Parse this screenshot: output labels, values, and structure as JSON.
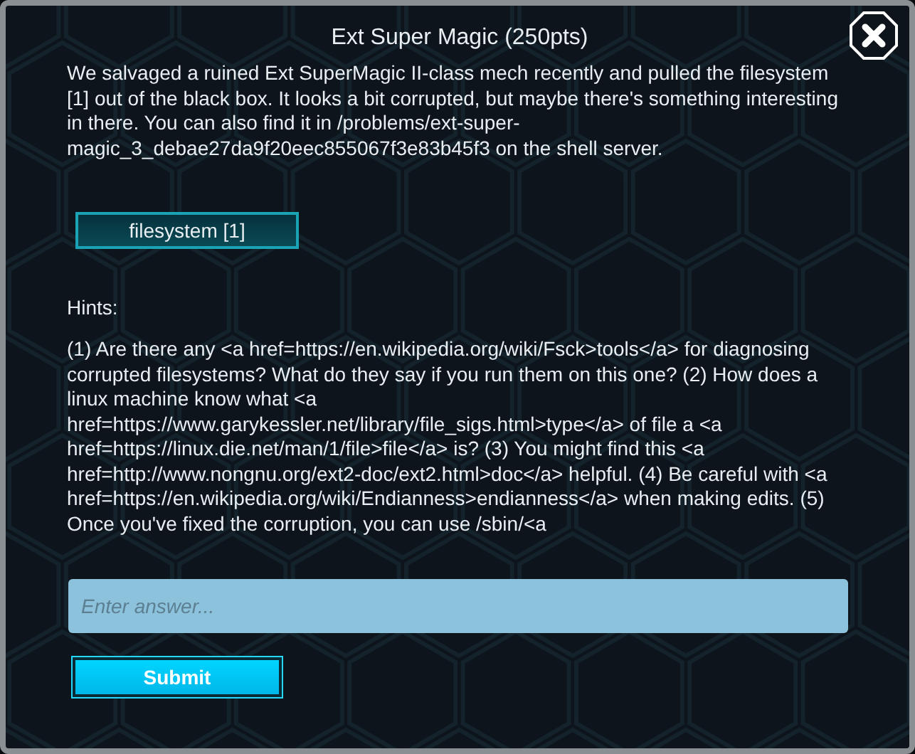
{
  "dialog": {
    "title": "Ext Super Magic (250pts)",
    "description": "We salvaged a ruined Ext SuperMagic II-class mech recently and pulled the filesystem [1] out of the black box.  It looks a bit corrupted, but maybe there's something interesting in there. You can also find it in /problems/ext-super-magic_3_debae27da9f20eec855067f3e83b45f3 on the shell server.",
    "file_button": "filesystem [1]",
    "hints_label": "Hints:",
    "hints": "(1) Are there any <a href=https://en.wikipedia.org/wiki/Fsck>tools</a> for diagnosing corrupted filesystems?  What do they say if you run them on this one? (2) How does a linux machine know what <a href=https://www.garykessler.net/library/file_sigs.html>type</a> of file a <a href=https://linux.die.net/man/1/file>file</a> is? (3) You might find this <a href=http://www.nongnu.org/ext2-doc/ext2.html>doc</a> helpful. (4) Be careful with <a href=https://en.wikipedia.org/wiki/Endianness>endianness</a> when making edits. (5) Once you've fixed the corruption, you can use /sbin/<a",
    "answer": {
      "placeholder": "Enter answer..."
    },
    "submit": "Submit"
  }
}
